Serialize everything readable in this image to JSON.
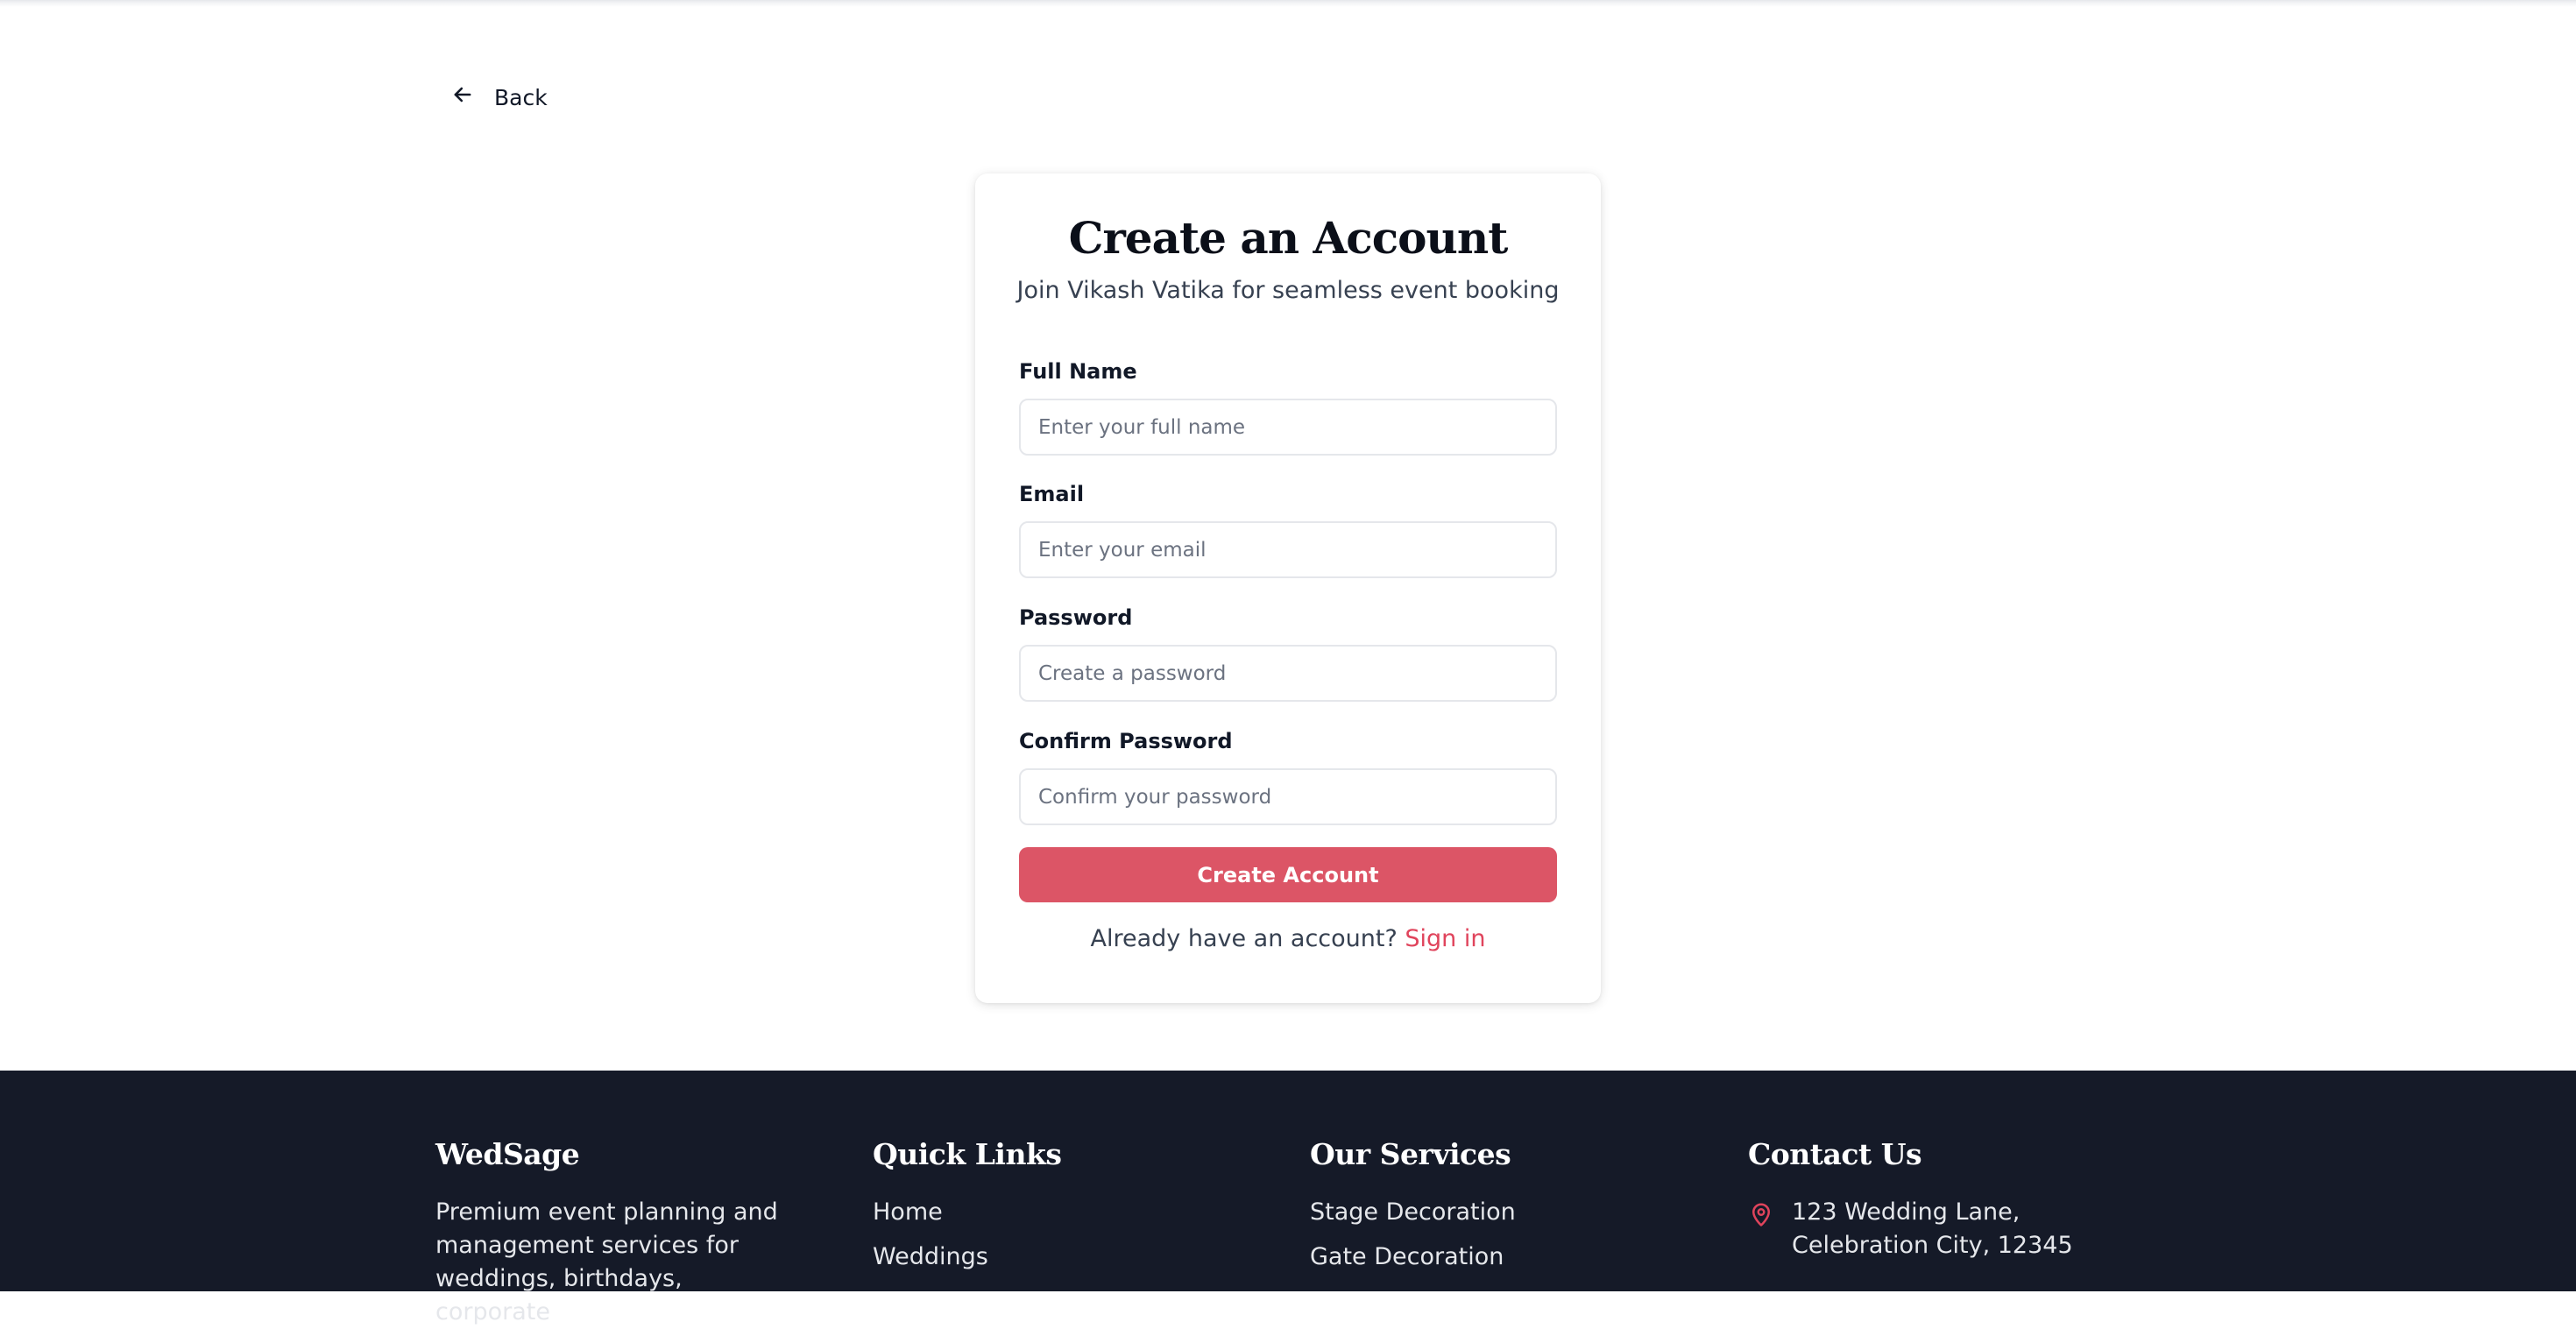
{
  "nav": {
    "back_label": "Back"
  },
  "form": {
    "title": "Create an Account",
    "subtitle": "Join Vikash Vatika for seamless event booking",
    "fields": [
      {
        "label": "Full Name",
        "placeholder": "Enter your full name",
        "value": ""
      },
      {
        "label": "Email",
        "placeholder": "Enter your email",
        "value": ""
      },
      {
        "label": "Password",
        "placeholder": "Create a password",
        "value": ""
      },
      {
        "label": "Confirm Password",
        "placeholder": "Confirm your password",
        "value": ""
      }
    ],
    "submit_label": "Create Account",
    "signin_prompt": "Already have an account?",
    "signin_link": "Sign in"
  },
  "footer": {
    "brand": {
      "title": "WedSage",
      "description": "Premium event planning and management services for weddings, birthdays, corporate"
    },
    "quick_links": {
      "title": "Quick Links",
      "items": [
        "Home",
        "Weddings"
      ]
    },
    "services": {
      "title": "Our Services",
      "items": [
        "Stage Decoration",
        "Gate Decoration"
      ]
    },
    "contact": {
      "title": "Contact Us",
      "address": "123 Wedding Lane, Celebration City, 12345"
    }
  },
  "colors": {
    "accent": "#dc5566",
    "link": "#e0445c",
    "footer_bg": "#151a28"
  },
  "icons": {
    "back": "arrow-left-icon",
    "address": "map-pin-icon"
  }
}
